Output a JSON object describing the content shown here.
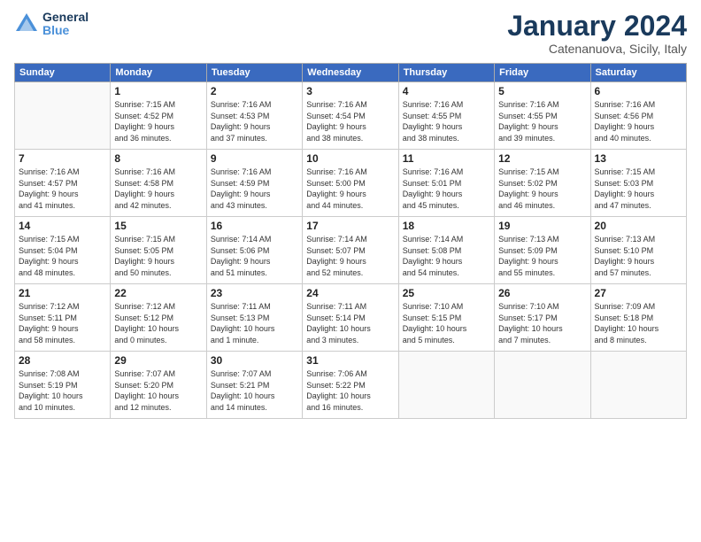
{
  "header": {
    "logo_line1": "General",
    "logo_line2": "Blue",
    "title": "January 2024",
    "subtitle": "Catenanuova, Sicily, Italy"
  },
  "weekdays": [
    "Sunday",
    "Monday",
    "Tuesday",
    "Wednesday",
    "Thursday",
    "Friday",
    "Saturday"
  ],
  "weeks": [
    [
      {
        "day": "",
        "info": ""
      },
      {
        "day": "1",
        "info": "Sunrise: 7:15 AM\nSunset: 4:52 PM\nDaylight: 9 hours\nand 36 minutes."
      },
      {
        "day": "2",
        "info": "Sunrise: 7:16 AM\nSunset: 4:53 PM\nDaylight: 9 hours\nand 37 minutes."
      },
      {
        "day": "3",
        "info": "Sunrise: 7:16 AM\nSunset: 4:54 PM\nDaylight: 9 hours\nand 38 minutes."
      },
      {
        "day": "4",
        "info": "Sunrise: 7:16 AM\nSunset: 4:55 PM\nDaylight: 9 hours\nand 38 minutes."
      },
      {
        "day": "5",
        "info": "Sunrise: 7:16 AM\nSunset: 4:55 PM\nDaylight: 9 hours\nand 39 minutes."
      },
      {
        "day": "6",
        "info": "Sunrise: 7:16 AM\nSunset: 4:56 PM\nDaylight: 9 hours\nand 40 minutes."
      }
    ],
    [
      {
        "day": "7",
        "info": "Sunrise: 7:16 AM\nSunset: 4:57 PM\nDaylight: 9 hours\nand 41 minutes."
      },
      {
        "day": "8",
        "info": "Sunrise: 7:16 AM\nSunset: 4:58 PM\nDaylight: 9 hours\nand 42 minutes."
      },
      {
        "day": "9",
        "info": "Sunrise: 7:16 AM\nSunset: 4:59 PM\nDaylight: 9 hours\nand 43 minutes."
      },
      {
        "day": "10",
        "info": "Sunrise: 7:16 AM\nSunset: 5:00 PM\nDaylight: 9 hours\nand 44 minutes."
      },
      {
        "day": "11",
        "info": "Sunrise: 7:16 AM\nSunset: 5:01 PM\nDaylight: 9 hours\nand 45 minutes."
      },
      {
        "day": "12",
        "info": "Sunrise: 7:15 AM\nSunset: 5:02 PM\nDaylight: 9 hours\nand 46 minutes."
      },
      {
        "day": "13",
        "info": "Sunrise: 7:15 AM\nSunset: 5:03 PM\nDaylight: 9 hours\nand 47 minutes."
      }
    ],
    [
      {
        "day": "14",
        "info": "Sunrise: 7:15 AM\nSunset: 5:04 PM\nDaylight: 9 hours\nand 48 minutes."
      },
      {
        "day": "15",
        "info": "Sunrise: 7:15 AM\nSunset: 5:05 PM\nDaylight: 9 hours\nand 50 minutes."
      },
      {
        "day": "16",
        "info": "Sunrise: 7:14 AM\nSunset: 5:06 PM\nDaylight: 9 hours\nand 51 minutes."
      },
      {
        "day": "17",
        "info": "Sunrise: 7:14 AM\nSunset: 5:07 PM\nDaylight: 9 hours\nand 52 minutes."
      },
      {
        "day": "18",
        "info": "Sunrise: 7:14 AM\nSunset: 5:08 PM\nDaylight: 9 hours\nand 54 minutes."
      },
      {
        "day": "19",
        "info": "Sunrise: 7:13 AM\nSunset: 5:09 PM\nDaylight: 9 hours\nand 55 minutes."
      },
      {
        "day": "20",
        "info": "Sunrise: 7:13 AM\nSunset: 5:10 PM\nDaylight: 9 hours\nand 57 minutes."
      }
    ],
    [
      {
        "day": "21",
        "info": "Sunrise: 7:12 AM\nSunset: 5:11 PM\nDaylight: 9 hours\nand 58 minutes."
      },
      {
        "day": "22",
        "info": "Sunrise: 7:12 AM\nSunset: 5:12 PM\nDaylight: 10 hours\nand 0 minutes."
      },
      {
        "day": "23",
        "info": "Sunrise: 7:11 AM\nSunset: 5:13 PM\nDaylight: 10 hours\nand 1 minute."
      },
      {
        "day": "24",
        "info": "Sunrise: 7:11 AM\nSunset: 5:14 PM\nDaylight: 10 hours\nand 3 minutes."
      },
      {
        "day": "25",
        "info": "Sunrise: 7:10 AM\nSunset: 5:15 PM\nDaylight: 10 hours\nand 5 minutes."
      },
      {
        "day": "26",
        "info": "Sunrise: 7:10 AM\nSunset: 5:17 PM\nDaylight: 10 hours\nand 7 minutes."
      },
      {
        "day": "27",
        "info": "Sunrise: 7:09 AM\nSunset: 5:18 PM\nDaylight: 10 hours\nand 8 minutes."
      }
    ],
    [
      {
        "day": "28",
        "info": "Sunrise: 7:08 AM\nSunset: 5:19 PM\nDaylight: 10 hours\nand 10 minutes."
      },
      {
        "day": "29",
        "info": "Sunrise: 7:07 AM\nSunset: 5:20 PM\nDaylight: 10 hours\nand 12 minutes."
      },
      {
        "day": "30",
        "info": "Sunrise: 7:07 AM\nSunset: 5:21 PM\nDaylight: 10 hours\nand 14 minutes."
      },
      {
        "day": "31",
        "info": "Sunrise: 7:06 AM\nSunset: 5:22 PM\nDaylight: 10 hours\nand 16 minutes."
      },
      {
        "day": "",
        "info": ""
      },
      {
        "day": "",
        "info": ""
      },
      {
        "day": "",
        "info": ""
      }
    ]
  ]
}
